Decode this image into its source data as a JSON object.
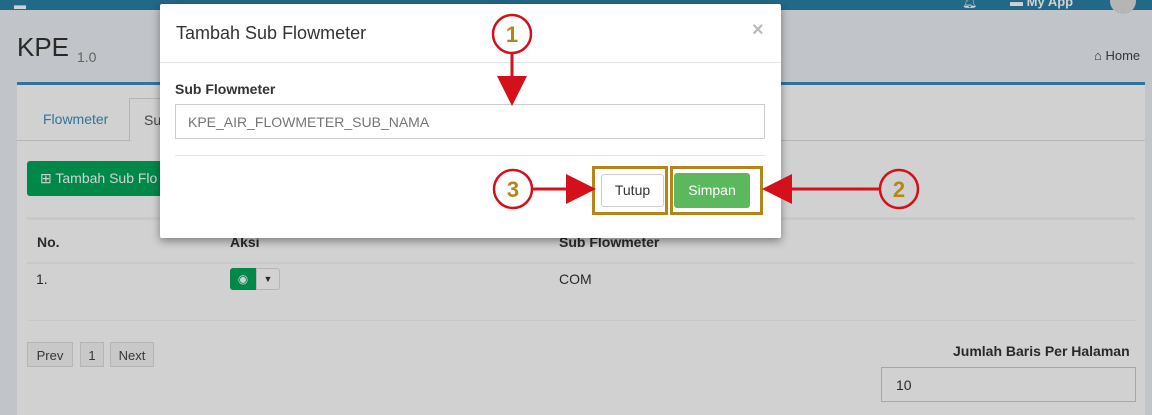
{
  "topbar": {
    "app_label": "My App",
    "menu_icon": "menu-icon",
    "bell_icon": "bell-icon"
  },
  "page": {
    "title": "KPE",
    "version": "1.0",
    "breadcrumb_home": "Home"
  },
  "tabs": [
    {
      "label": "Flowmeter"
    },
    {
      "label": "Su"
    }
  ],
  "toolbar": {
    "add_label": "Tambah Sub Flo"
  },
  "table": {
    "headers": [
      "No.",
      "Aksi",
      "Sub Flowmeter"
    ],
    "rows": [
      {
        "no": "1.",
        "sub_flowmeter": "COM"
      }
    ]
  },
  "pagination": {
    "prev": "Prev",
    "page": "1",
    "next": "Next"
  },
  "rows_per_page": {
    "label": "Jumlah Baris Per Halaman",
    "value": "10"
  },
  "modal": {
    "title": "Tambah Sub Flowmeter",
    "close": "×",
    "field_label": "Sub Flowmeter",
    "field_placeholder": "KPE_AIR_FLOWMETER_SUB_NAMA",
    "btn_close": "Tutup",
    "btn_save": "Simpan"
  },
  "annotations": {
    "marker1": "1",
    "marker2": "2",
    "marker3": "3",
    "color": "#b5851a",
    "arrow_color": "#d4111a"
  }
}
